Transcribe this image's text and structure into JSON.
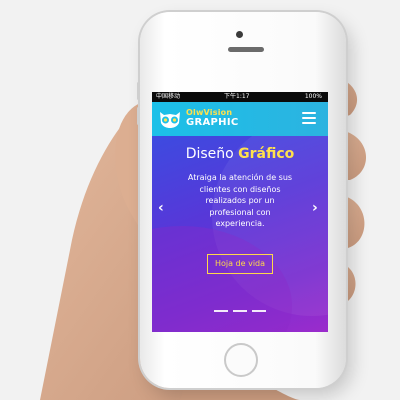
{
  "status_bar": {
    "carrier": "中国移动",
    "time": "下午1:17",
    "battery": "100%"
  },
  "brand": {
    "line1": "OlwVision",
    "line2": "GRAPHIC"
  },
  "hero": {
    "title_plain": "Diseño",
    "title_accent": "Gráfico",
    "description": "Atraiga la atención de sus clientes con diseños realizados por un profesional con experiencia.",
    "cta_label": "Hoja de vida",
    "prev_arrow": "‹",
    "next_arrow": "›"
  },
  "colors": {
    "nav_bg": "#1cc0e8",
    "accent_yellow": "#ffe14d",
    "hero_gradient_start": "#3d4be0",
    "hero_gradient_end": "#9b2ccc"
  },
  "icons": [
    "owl-logo-icon",
    "hamburger-menu-icon",
    "chevron-left-icon",
    "chevron-right-icon"
  ]
}
